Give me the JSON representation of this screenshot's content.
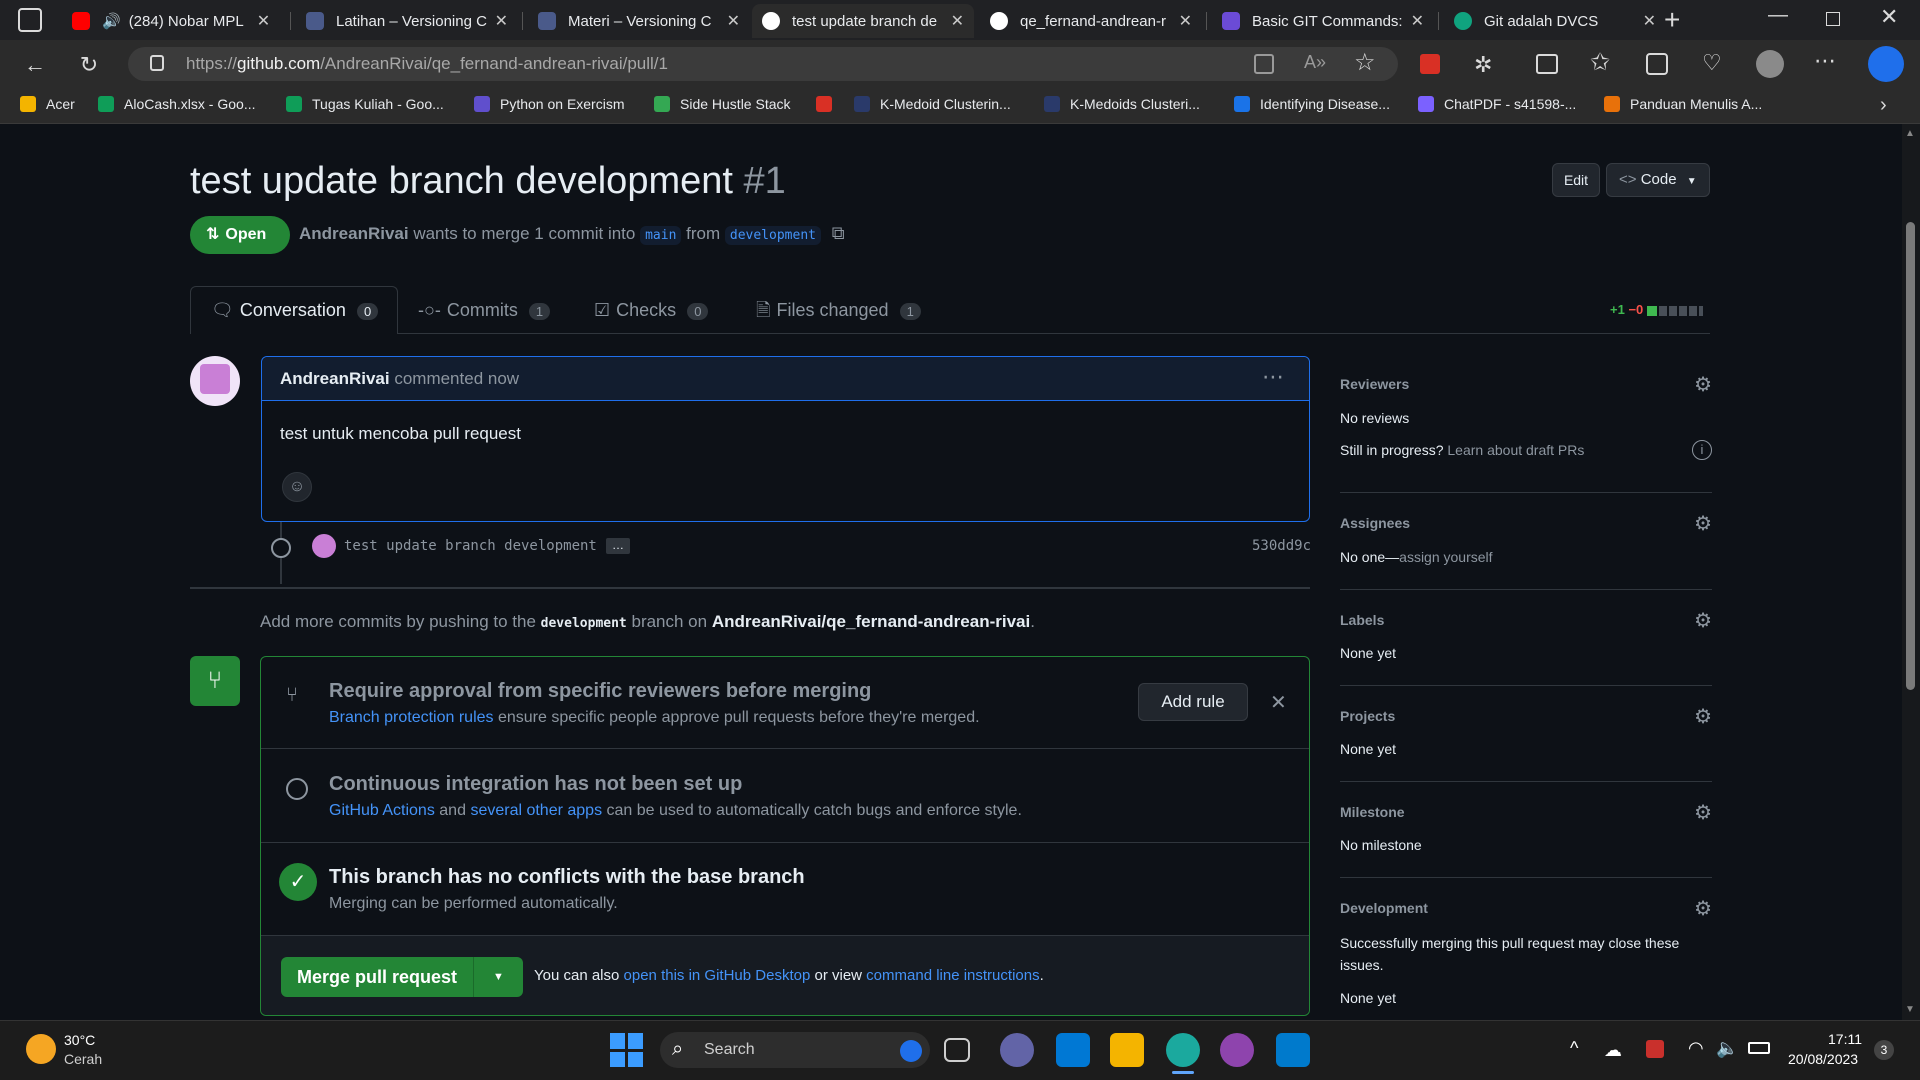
{
  "browser": {
    "tabs": [
      {
        "label": "(284) Nobar MPL",
        "color": "#ff0000"
      },
      {
        "label": "Latihan – Versioning C",
        "color": "#4a5a8a"
      },
      {
        "label": "Materi – Versioning C",
        "color": "#4a5a8a"
      },
      {
        "label": "test update branch de",
        "color": "#ffffff"
      },
      {
        "label": "qe_fernand-andrean-r",
        "color": "#ffffff"
      },
      {
        "label": "Basic GIT Commands:",
        "color": "#6b4bd6"
      },
      {
        "label": "Git adalah DVCS",
        "color": "#10a37f"
      }
    ],
    "url_prefix": "https://",
    "url_host": "github.com",
    "url_path": "/AndreanRivai/qe_fernand-andrean-rivai/pull/1",
    "bookmarks": [
      {
        "label": "Acer",
        "color": "#f4b400"
      },
      {
        "label": "AloCash.xlsx - Goo...",
        "color": "#0f9d58"
      },
      {
        "label": "Tugas Kuliah - Goo...",
        "color": "#0f9d58"
      },
      {
        "label": "Python on Exercism",
        "color": "#604fcd"
      },
      {
        "label": "Side Hustle Stack",
        "color": "#34a853"
      },
      {
        "label": "",
        "color": "#d93025"
      },
      {
        "label": "K-Medoid Clusterin...",
        "color": "#2a3a6a"
      },
      {
        "label": "K-Medoids Clusteri...",
        "color": "#2a3a6a"
      },
      {
        "label": "Identifying Disease...",
        "color": "#1a73e8"
      },
      {
        "label": "ChatPDF - s41598-...",
        "color": "#7b61ff"
      },
      {
        "label": "Panduan Menulis A...",
        "color": "#e8710a"
      }
    ]
  },
  "pr": {
    "title": "test update branch development",
    "number": "#1",
    "status": "Open",
    "author": "AndreanRivai",
    "merge_text_1": "wants to merge 1 commit into",
    "base_branch": "main",
    "from_text": "from",
    "head_branch": "development",
    "edit_label": "Edit",
    "code_label": "Code",
    "tabs": [
      {
        "label": "Conversation",
        "count": "0"
      },
      {
        "label": "Commits",
        "count": "1"
      },
      {
        "label": "Checks",
        "count": "0"
      },
      {
        "label": "Files changed",
        "count": "1"
      }
    ],
    "diff_add": "+1",
    "diff_del": "−0",
    "comment": {
      "author": "AndreanRivai",
      "meta": "commented now",
      "body": "test untuk mencoba pull request"
    },
    "commit": {
      "message": "test update branch development",
      "ellipsis": "…",
      "sha": "530dd9c"
    },
    "push_hint": {
      "pre": "Add more commits by pushing to the",
      "branch": "development",
      "mid": "branch on",
      "repo": "AndreanRivai/qe_fernand-andrean-rivai",
      "end": "."
    },
    "merge_box": {
      "rule_title": "Require approval from specific reviewers before merging",
      "rule_link": "Branch protection rules",
      "rule_desc": "ensure specific people approve pull requests before they're merged.",
      "add_rule": "Add rule",
      "ci_title": "Continuous integration has not been set up",
      "ci_link1": "GitHub Actions",
      "ci_and": "and",
      "ci_link2": "several other apps",
      "ci_desc": "can be used to automatically catch bugs and enforce style.",
      "ok_title": "This branch has no conflicts with the base branch",
      "ok_desc": "Merging can be performed automatically.",
      "merge_button": "Merge pull request",
      "also_text": "You can also",
      "also_link1": "open this in GitHub Desktop",
      "also_or": "or view",
      "also_link2": "command line instructions",
      "also_end": "."
    },
    "sidebar": {
      "reviewers_title": "Reviewers",
      "reviewers_value": "No reviews",
      "draft_text": "Still in progress?",
      "draft_link": "Learn about draft PRs",
      "assignees_title": "Assignees",
      "assignees_value": "No one—",
      "assignees_link": "assign yourself",
      "labels_title": "Labels",
      "labels_value": "None yet",
      "projects_title": "Projects",
      "projects_value": "None yet",
      "milestone_title": "Milestone",
      "milestone_value": "No milestone",
      "development_title": "Development",
      "development_desc": "Successfully merging this pull request may close these issues.",
      "development_value": "None yet"
    }
  },
  "taskbar": {
    "weather_temp": "30°C",
    "weather_desc": "Cerah",
    "search_label": "Search",
    "time": "17:11",
    "date": "20/08/2023",
    "notif_count": "3"
  }
}
